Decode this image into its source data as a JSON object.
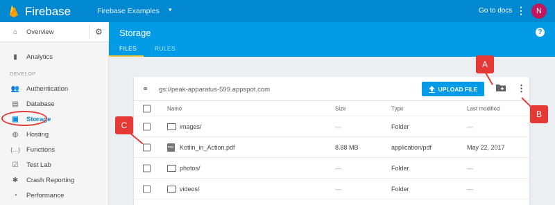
{
  "topbar": {
    "brand": "Firebase",
    "project": "Firebase Examples",
    "project_caret": "▾",
    "docs_link": "Go to docs",
    "more": "⋮",
    "avatar_initial": "N"
  },
  "sidebar": {
    "overview": "Overview",
    "settings_icon": "⚙",
    "analytics": "Analytics",
    "section_develop": "DEVELOP",
    "items": [
      {
        "label": "Authentication",
        "icon": "👥",
        "active": false
      },
      {
        "label": "Database",
        "icon": "▤",
        "active": false
      },
      {
        "label": "Storage",
        "icon": "▣",
        "active": true
      },
      {
        "label": "Hosting",
        "icon": "◍",
        "active": false
      },
      {
        "label": "Functions",
        "icon": "{…}",
        "active": false
      },
      {
        "label": "Test Lab",
        "icon": "☑",
        "active": false
      },
      {
        "label": "Crash Reporting",
        "icon": "✱",
        "active": false
      },
      {
        "label": "Performance",
        "icon": "◔",
        "active": false
      }
    ]
  },
  "storage": {
    "title": "Storage",
    "help": "?",
    "tabs": [
      {
        "label": "FILES",
        "active": true
      },
      {
        "label": "RULES",
        "active": false
      }
    ]
  },
  "card": {
    "bucket": "gs://peak-apparatus-599.appspot.com",
    "upload_label": "UPLOAD FILE",
    "columns": [
      "Name",
      "Size",
      "Type",
      "Last modified"
    ],
    "rows": [
      {
        "name": "images/",
        "kind": "folder",
        "size": "—",
        "type": "Folder",
        "modified": "—"
      },
      {
        "name": "Kotlin_in_Action.pdf",
        "kind": "pdf",
        "size": "8.88 MB",
        "type": "application/pdf",
        "modified": "May 22, 2017"
      },
      {
        "name": "photos/",
        "kind": "folder",
        "size": "—",
        "type": "Folder",
        "modified": "—"
      },
      {
        "name": "videos/",
        "kind": "folder",
        "size": "—",
        "type": "Folder",
        "modified": "—"
      }
    ]
  },
  "callouts": {
    "a": "A",
    "b": "B",
    "c": "C"
  },
  "colors": {
    "primary": "#039be5",
    "topbar": "#0288d1",
    "accent_tab": "#ffca28",
    "callout": "#e53935",
    "avatar": "#c2185b"
  }
}
